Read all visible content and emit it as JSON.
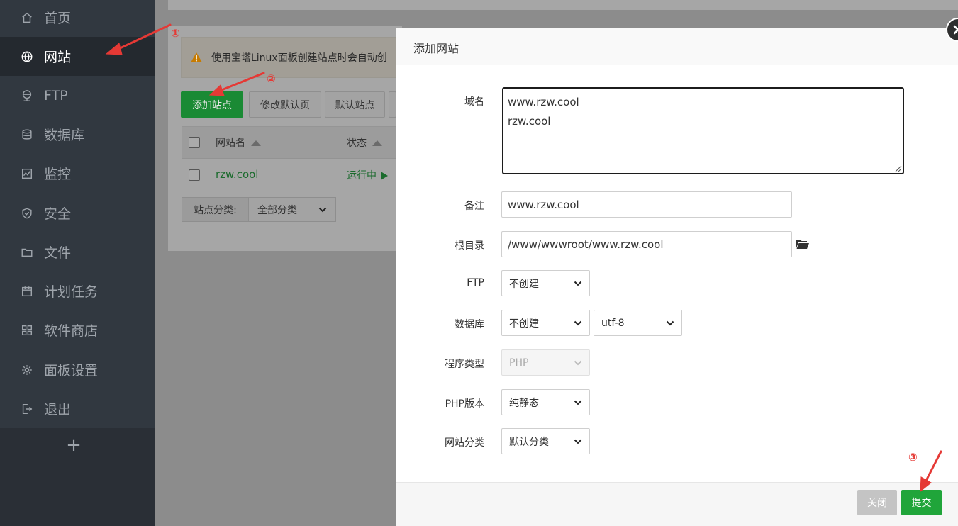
{
  "sidebar": {
    "items": [
      {
        "label": "首页",
        "icon": "home-icon",
        "active": false
      },
      {
        "label": "网站",
        "icon": "globe-icon",
        "active": true
      },
      {
        "label": "FTP",
        "icon": "ftp-icon",
        "active": false
      },
      {
        "label": "数据库",
        "icon": "database-icon",
        "active": false
      },
      {
        "label": "监控",
        "icon": "monitor-icon",
        "active": false
      },
      {
        "label": "安全",
        "icon": "shield-icon",
        "active": false
      },
      {
        "label": "文件",
        "icon": "folder-icon",
        "active": false
      },
      {
        "label": "计划任务",
        "icon": "calendar-icon",
        "active": false
      },
      {
        "label": "软件商店",
        "icon": "grid-icon",
        "active": false
      },
      {
        "label": "面板设置",
        "icon": "gear-icon",
        "active": false
      },
      {
        "label": "退出",
        "icon": "logout-icon",
        "active": false
      }
    ],
    "add_label": "+"
  },
  "background": {
    "alert_text": "使用宝塔Linux面板创建站点时会自动创",
    "buttons": {
      "add_site": "添加站点",
      "edit_default_page": "修改默认页",
      "default_site": "默认站点"
    },
    "table": {
      "headers": {
        "site_name": "网站名",
        "status": "状态"
      },
      "rows": [
        {
          "site_name": "rzw.cool",
          "status": "运行中"
        }
      ]
    },
    "category": {
      "label": "站点分类:",
      "value": "全部分类"
    }
  },
  "annotations": {
    "one": "①",
    "two": "②",
    "three": "③"
  },
  "modal": {
    "title": "添加网站",
    "close_symbol": "×",
    "fields": {
      "domain": {
        "label": "域名",
        "value": "www.rzw.cool\nrzw.cool"
      },
      "remark": {
        "label": "备注",
        "value": "www.rzw.cool"
      },
      "root": {
        "label": "根目录",
        "value": "/www/wwwroot/www.rzw.cool"
      },
      "ftp": {
        "label": "FTP",
        "value": "不创建"
      },
      "database": {
        "label": "数据库",
        "value": "不创建",
        "charset": "utf-8"
      },
      "program_type": {
        "label": "程序类型",
        "value": "PHP"
      },
      "php_version": {
        "label": "PHP版本",
        "value": "纯静态"
      },
      "site_category": {
        "label": "网站分类",
        "value": "默认分类"
      }
    },
    "buttons": {
      "close": "关闭",
      "submit": "提交"
    }
  },
  "colors": {
    "sidebar_bg": "#313840",
    "accent_green": "#20a53a",
    "annotation_red": "#e53935"
  }
}
